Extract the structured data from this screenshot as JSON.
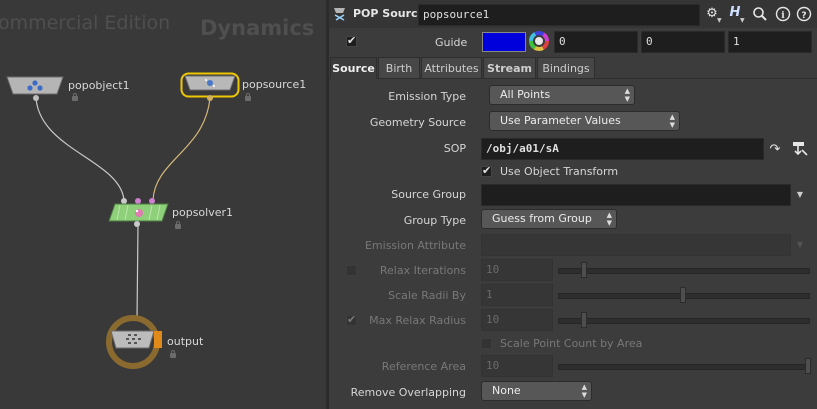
{
  "network": {
    "watermark_edition": "ommercial Edition",
    "watermark_context": "Dynamics",
    "nodes": [
      {
        "name": "popobject1"
      },
      {
        "name": "popsource1"
      },
      {
        "name": "popsolver1"
      },
      {
        "name": "output"
      }
    ]
  },
  "header": {
    "node_type": "POP Source",
    "node_name": "popsource1",
    "help_icon": "help-icon",
    "info_icon": "info-icon"
  },
  "guide": {
    "label": "Guide",
    "checked": true,
    "color_hex": "#0000dd",
    "rgb": [
      "0",
      "0",
      "1"
    ]
  },
  "tabs": [
    {
      "label": "Source",
      "active": true
    },
    {
      "label": "Birth"
    },
    {
      "label": "Attributes"
    },
    {
      "label": "Stream"
    },
    {
      "label": "Bindings"
    }
  ],
  "parms": {
    "emission_type": {
      "label": "Emission Type",
      "value": "All Points"
    },
    "geometry_source": {
      "label": "Geometry Source",
      "value": "Use Parameter Values"
    },
    "sop": {
      "label": "SOP",
      "value": "/obj/a01/sA"
    },
    "use_object_transform": {
      "label": "Use Object Transform",
      "checked": true
    },
    "source_group": {
      "label": "Source Group",
      "value": ""
    },
    "group_type": {
      "label": "Group Type",
      "value": "Guess from Group"
    },
    "emission_attribute": {
      "label": "Emission Attribute",
      "value": ""
    },
    "relax_iterations": {
      "label": "Relax Iterations",
      "value": "10",
      "checked": false
    },
    "scale_radii_by": {
      "label": "Scale Radii By",
      "value": "1"
    },
    "max_relax_radius": {
      "label": "Max Relax Radius",
      "value": "10",
      "checked": true
    },
    "scale_point_count": {
      "label": "Scale Point Count by Area",
      "checked": false
    },
    "reference_area": {
      "label": "Reference Area",
      "value": "10"
    },
    "remove_overlapping": {
      "label": "Remove Overlapping",
      "value": "None"
    }
  },
  "colors": {
    "selected_node": "#f0c800",
    "solver_node": "#8ed07a",
    "output_ring": "#8a6a2e",
    "output_flag": "#e08a1a"
  }
}
